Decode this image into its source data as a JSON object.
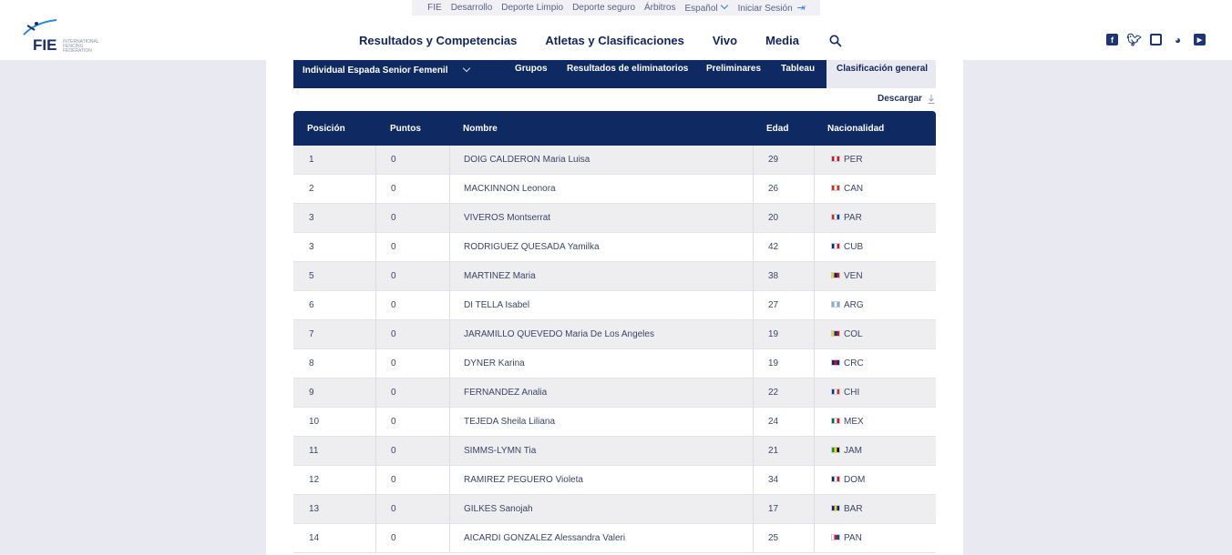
{
  "topbar": {
    "items": [
      "FIE",
      "Desarrollo",
      "Deporte Limpio",
      "Deporte seguro",
      "Árbitros",
      "Español",
      "Iniciar Sesión"
    ]
  },
  "header": {
    "logo_text": "FIE",
    "logo_subtitle": "INTERNATIONAL FENCING FEDERATION",
    "nav": [
      "Resultados y Competencias",
      "Atletas y Clasificaciones",
      "Vivo",
      "Media"
    ],
    "social_icons": [
      "facebook-icon",
      "twitter-icon",
      "instagram-icon",
      "weibo-icon",
      "youtube-icon"
    ]
  },
  "subnav": {
    "event": "Individual Espada Senior Femenil",
    "tabs": [
      "Grupos",
      "Resultados de eliminatorios",
      "Preliminares",
      "Tableau",
      "Clasificación general"
    ],
    "active_tab": "Clasificación general"
  },
  "download_label": "Descargar",
  "table": {
    "headers": [
      "Posición",
      "Puntos",
      "Nombre",
      "Edad",
      "Nacionalidad"
    ],
    "rows": [
      {
        "pos": "1",
        "pts": "0",
        "name": "DOIG CALDERON Maria Luisa",
        "age": "29",
        "nat": "PER",
        "flag": [
          "#d91023",
          "#ffffff",
          "#d91023"
        ]
      },
      {
        "pos": "2",
        "pts": "0",
        "name": "MACKINNON Leonora",
        "age": "26",
        "nat": "CAN",
        "flag": [
          "#d52b1e",
          "#ffffff",
          "#d52b1e"
        ]
      },
      {
        "pos": "3",
        "pts": "0",
        "name": "VIVEROS Montserrat",
        "age": "20",
        "nat": "PAR",
        "flag": [
          "#d52b1e",
          "#ffffff",
          "#0038a8"
        ]
      },
      {
        "pos": "3",
        "pts": "0",
        "name": "RODRIGUEZ QUESADA Yamilka",
        "age": "42",
        "nat": "CUB",
        "flag": [
          "#002a8f",
          "#ffffff",
          "#cf142b"
        ]
      },
      {
        "pos": "5",
        "pts": "0",
        "name": "MARTINEZ Maria",
        "age": "38",
        "nat": "VEN",
        "flag": [
          "#ffcc00",
          "#00247d",
          "#cf142b"
        ]
      },
      {
        "pos": "6",
        "pts": "0",
        "name": "DI TELLA Isabel",
        "age": "27",
        "nat": "ARG",
        "flag": [
          "#74acdf",
          "#ffffff",
          "#74acdf"
        ]
      },
      {
        "pos": "7",
        "pts": "0",
        "name": "JARAMILLO QUEVEDO Maria De Los Angeles",
        "age": "19",
        "nat": "COL",
        "flag": [
          "#fcd116",
          "#003893",
          "#ce1126"
        ]
      },
      {
        "pos": "8",
        "pts": "0",
        "name": "DYNER Karina",
        "age": "19",
        "nat": "CRC",
        "flag": [
          "#002b7f",
          "#ce1126",
          "#002b7f"
        ]
      },
      {
        "pos": "9",
        "pts": "0",
        "name": "FERNANDEZ Analia",
        "age": "22",
        "nat": "CHI",
        "flag": [
          "#0039a6",
          "#ffffff",
          "#d52b1e"
        ]
      },
      {
        "pos": "10",
        "pts": "0",
        "name": "TEJEDA Sheila Liliana",
        "age": "24",
        "nat": "MEX",
        "flag": [
          "#006847",
          "#ffffff",
          "#ce1126"
        ]
      },
      {
        "pos": "11",
        "pts": "0",
        "name": "SIMMS-LYMN Tia",
        "age": "21",
        "nat": "JAM",
        "flag": [
          "#009b3a",
          "#fed100",
          "#000000"
        ]
      },
      {
        "pos": "12",
        "pts": "0",
        "name": "RAMIREZ PEGUERO Violeta",
        "age": "34",
        "nat": "DOM",
        "flag": [
          "#002d62",
          "#ffffff",
          "#ce1126"
        ]
      },
      {
        "pos": "13",
        "pts": "0",
        "name": "GILKES Sanojah",
        "age": "17",
        "nat": "BAR",
        "flag": [
          "#00267f",
          "#ffc726",
          "#00267f"
        ]
      },
      {
        "pos": "14",
        "pts": "0",
        "name": "AICARDI GONZALEZ Alessandra Valeri",
        "age": "25",
        "nat": "PAN",
        "flag": [
          "#ffffff",
          "#d21034",
          "#005293"
        ]
      }
    ]
  },
  "colors": {
    "navy": "#0f2962",
    "page_bg": "#e9e9f1",
    "accent": "#2c7be5"
  }
}
